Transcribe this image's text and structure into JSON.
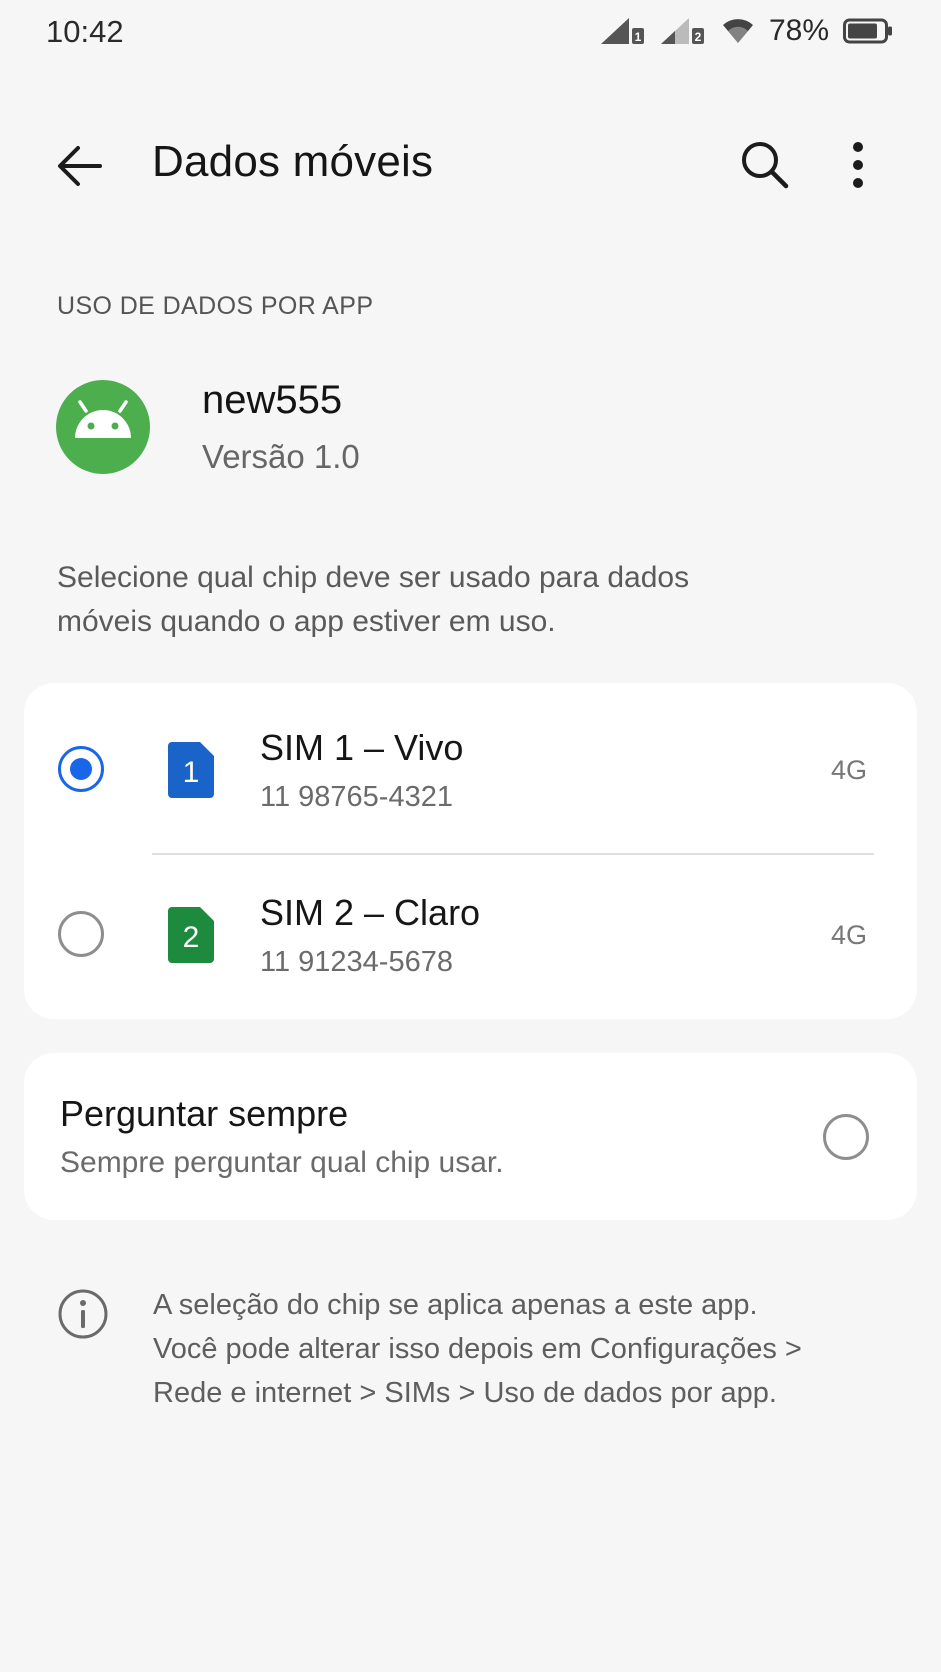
{
  "status_bar": {
    "time": "10:42",
    "battery": "78%",
    "sim1_index": "1",
    "sim2_index": "2"
  },
  "app_bar": {
    "title": "Dados móveis",
    "back_icon": "arrow-left-icon",
    "search_icon": "search-icon",
    "more_icon": "more-vert-icon"
  },
  "section": {
    "header": "USO DE DADOS POR APP"
  },
  "app": {
    "name": "new555",
    "version": "Versão 1.0",
    "icon": "android-icon"
  },
  "description": "Selecione qual chip deve ser usado para dados móveis quando o app estiver em uso.",
  "sims": [
    {
      "badge": "1",
      "title": "SIM 1 – Vivo",
      "number": "11 98765-4321",
      "network": "4G",
      "selected": true,
      "color": "#1a63c8"
    },
    {
      "badge": "2",
      "title": "SIM 2 – Claro",
      "number": "11 91234-5678",
      "network": "4G",
      "selected": false,
      "color": "#1e8a3e"
    }
  ],
  "ask_always": {
    "title": "Perguntar sempre",
    "subtitle": "Sempre perguntar qual chip usar.",
    "selected": false
  },
  "info": {
    "icon": "info-icon",
    "text_lines": [
      "A seleção do chip se aplica apenas a este app.",
      "Você pode alterar isso depois em Configurações >",
      "Rede e internet > SIMs > Uso de dados por app."
    ]
  },
  "colors": {
    "accent": "#1a66e8",
    "background": "#f6f6f6",
    "card": "#ffffff",
    "app_icon_bg": "#4cae4c"
  }
}
